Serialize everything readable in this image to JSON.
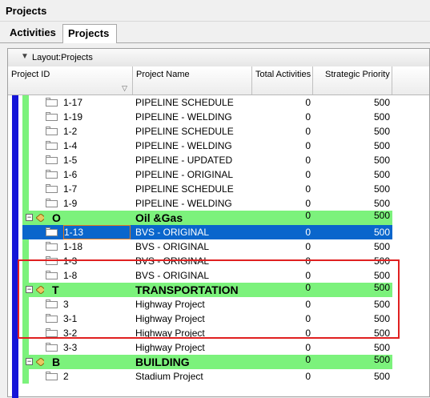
{
  "window": {
    "title": "Projects"
  },
  "tabs": [
    {
      "label": "Activities"
    },
    {
      "label": "Projects"
    }
  ],
  "layout": {
    "label": "Layout:Projects"
  },
  "columns": {
    "project_id": "Project ID",
    "project_name": "Project Name",
    "total_activities": "Total Activities",
    "strategic_priority": "Strategic Priority"
  },
  "colors": {
    "group_green": "#7cf27c",
    "selection_blue": "#0a66cc",
    "eps_blue": "#1515d8",
    "highlight_red": "#e02020"
  },
  "rows": [
    {
      "type": "project",
      "id": "1-17",
      "name": "PIPELINE SCHEDULE",
      "activities": "0",
      "priority": "500"
    },
    {
      "type": "project",
      "id": "1-19",
      "name": "PIPELINE - WELDING",
      "activities": "0",
      "priority": "500"
    },
    {
      "type": "project",
      "id": "1-2",
      "name": "PIPELINE SCHEDULE",
      "activities": "0",
      "priority": "500"
    },
    {
      "type": "project",
      "id": "1-4",
      "name": "PIPELINE - WELDING",
      "activities": "0",
      "priority": "500"
    },
    {
      "type": "project",
      "id": "1-5",
      "name": "PIPELINE - UPDATED",
      "activities": "0",
      "priority": "500"
    },
    {
      "type": "project",
      "id": "1-6",
      "name": "PIPELINE - ORIGINAL",
      "activities": "0",
      "priority": "500"
    },
    {
      "type": "project",
      "id": "1-7",
      "name": "PIPELINE SCHEDULE",
      "activities": "0",
      "priority": "500"
    },
    {
      "type": "project",
      "id": "1-9",
      "name": "PIPELINE - WELDING",
      "activities": "0",
      "priority": "500"
    },
    {
      "type": "group",
      "expander": "−",
      "id": "O",
      "name": "Oil &Gas",
      "activities": "0",
      "priority": "500"
    },
    {
      "type": "project",
      "selected": true,
      "id": "1-13",
      "name": "BVS - ORIGINAL",
      "activities": "0",
      "priority": "500"
    },
    {
      "type": "project",
      "id": "1-18",
      "name": "BVS - ORIGINAL",
      "activities": "0",
      "priority": "500"
    },
    {
      "type": "project",
      "id": "1-3",
      "name": "BVS - ORIGINAL",
      "activities": "0",
      "priority": "500"
    },
    {
      "type": "project",
      "id": "1-8",
      "name": "BVS - ORIGINAL",
      "activities": "0",
      "priority": "500"
    },
    {
      "type": "group",
      "expander": "−",
      "id": "T",
      "name": "TRANSPORTATION",
      "activities": "0",
      "priority": "500"
    },
    {
      "type": "project",
      "id": "3",
      "name": "Highway Project",
      "activities": "0",
      "priority": "500"
    },
    {
      "type": "project",
      "id": "3-1",
      "name": "Highway Project",
      "activities": "0",
      "priority": "500"
    },
    {
      "type": "project",
      "id": "3-2",
      "name": "Highway Project",
      "activities": "0",
      "priority": "500"
    },
    {
      "type": "project",
      "id": "3-3",
      "name": "Highway Project",
      "activities": "0",
      "priority": "500"
    },
    {
      "type": "group",
      "expander": "−",
      "id": "B",
      "name": "BUILDING",
      "activities": "0",
      "priority": "500"
    },
    {
      "type": "project",
      "id": "2",
      "name": "Stadium Project",
      "activities": "0",
      "priority": "500"
    }
  ]
}
